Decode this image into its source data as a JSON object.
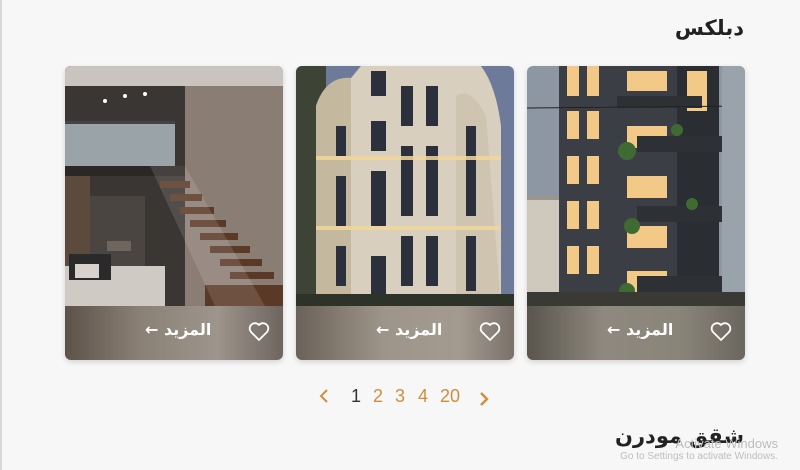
{
  "sections": {
    "duplex_title": "دبلكس",
    "modern_title": "شقق مودرن"
  },
  "cards": [
    {
      "more_label": "المزيد ←",
      "image": "modern-building-night-photo",
      "icon": "heart-icon"
    },
    {
      "more_label": "المزيد ←",
      "image": "classic-building-night-photo",
      "icon": "heart-icon"
    },
    {
      "more_label": "المزيد ←",
      "image": "duplex-interior-staircase-photo",
      "icon": "heart-icon"
    }
  ],
  "pagination": {
    "prev_icon": "chevron-left-icon",
    "next_icon": "chevron-right-icon",
    "pages": [
      "1",
      "2",
      "3",
      "4",
      "20"
    ],
    "current": "1"
  },
  "watermark": {
    "line1": "Activate Windows",
    "line2": "Go to Settings to activate Windows."
  },
  "colors": {
    "accent": "#d18d3c",
    "card_footer": "#8e877e",
    "title": "#222222"
  }
}
